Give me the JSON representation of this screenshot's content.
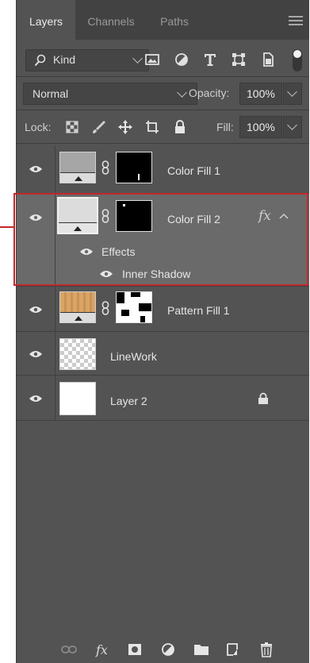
{
  "tabs": [
    {
      "label": "Layers",
      "active": true
    },
    {
      "label": "Channels",
      "active": false
    },
    {
      "label": "Paths",
      "active": false
    }
  ],
  "filter": {
    "kind_label": "Kind"
  },
  "blend": {
    "mode": "Normal",
    "opacity_label": "Opacity:",
    "opacity_value": "100%"
  },
  "lock": {
    "label": "Lock:",
    "fill_label": "Fill:",
    "fill_value": "100%"
  },
  "layers": [
    {
      "name": "Color Fill 1"
    },
    {
      "name": "Color Fill 2",
      "fx": "fx",
      "effects_label": "Effects",
      "effect_item": "Inner Shadow"
    },
    {
      "name": "Pattern Fill 1"
    },
    {
      "name": "LineWork"
    },
    {
      "name": "Layer 2"
    }
  ],
  "colors": {
    "panel_bg": "#535353",
    "selected_bg": "#6a6a6a",
    "highlight": "#c1272d"
  }
}
